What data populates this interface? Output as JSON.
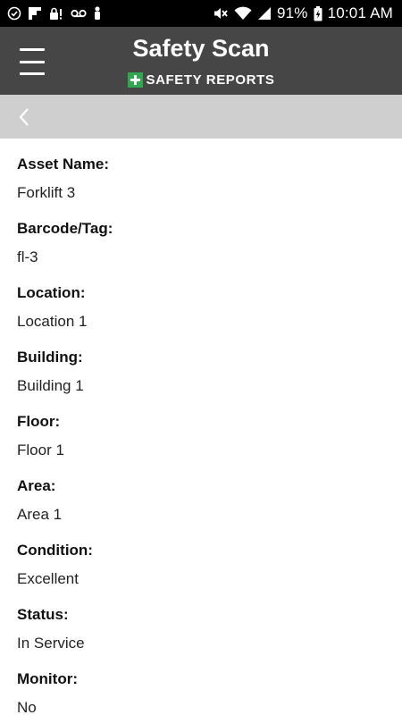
{
  "status_bar": {
    "battery": "91%",
    "time": "10:01 AM"
  },
  "header": {
    "title": "Safety Scan",
    "brand": "SAFETY REPORTS"
  },
  "fields": [
    {
      "label": "Asset Name:",
      "value": "Forklift 3"
    },
    {
      "label": "Barcode/Tag:",
      "value": "fl-3"
    },
    {
      "label": "Location:",
      "value": "Location 1"
    },
    {
      "label": "Building:",
      "value": "Building 1"
    },
    {
      "label": "Floor:",
      "value": "Floor 1"
    },
    {
      "label": "Area:",
      "value": "Area 1"
    },
    {
      "label": "Condition:",
      "value": "Excellent"
    },
    {
      "label": "Status:",
      "value": "In Service"
    },
    {
      "label": "Monitor:",
      "value": "No"
    }
  ],
  "colors": {
    "header_bg": "#464646",
    "back_bar_bg": "#cfcfcf",
    "brand_green": "#2fa84f"
  }
}
